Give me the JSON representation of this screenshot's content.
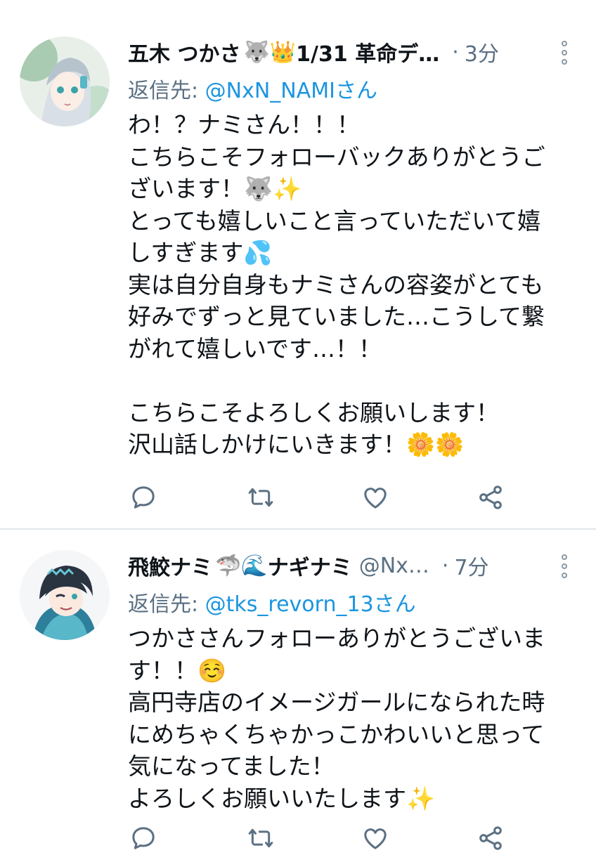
{
  "tweets": [
    {
      "author_name": "五木 つかさ",
      "name_emojis": "🐺👑",
      "name_suffix": " 1/31 革命デ…",
      "handle": "",
      "dot": "·",
      "time": "3分",
      "reply_prefix": "返信先: ",
      "reply_to": "@NxN_NAMIさん",
      "body_lines": [
        "わ！？ナミさん！！！",
        "こちらこそフォローバックありがとうご",
        "ざいます！🐺✨",
        "とっても嬉しいこと言っていただいて嬉",
        "しすぎます💦",
        "実は自分自身もナミさんの容姿がとても",
        "好みでずっと見ていました…こうして繋",
        "がれて嬉しいです…！！",
        "",
        "こちらこそよろしくお願いします！",
        "沢山話しかけにいきます！🌼🌼"
      ],
      "reply_count": "",
      "retweet_count": "",
      "like_count": ""
    },
    {
      "author_name": "飛鮫ナミ",
      "name_emojis": "🦈🌊",
      "name_suffix": "ナギナミ",
      "handle": "@Nx…",
      "dot": "·",
      "time": "7分",
      "reply_prefix": "返信先: ",
      "reply_to": "@tks_revorn_13さん",
      "body_lines": [
        "つかささんフォローありがとうございま",
        "す！！☺️",
        "高円寺店のイメージガールになられた時",
        "にめちゃくちゃかっこかわいいと思って",
        "気になってました！",
        "よろしくお願いいたします✨"
      ],
      "reply_count": "",
      "retweet_count": "",
      "like_count": ""
    }
  ],
  "colors": {
    "text": "#0f1419",
    "secondary": "#5b7083",
    "link": "#1b95e0",
    "divider": "#e1e6ea"
  },
  "icons": [
    "reply-icon",
    "retweet-icon",
    "like-icon",
    "share-icon",
    "more-options-icon"
  ]
}
